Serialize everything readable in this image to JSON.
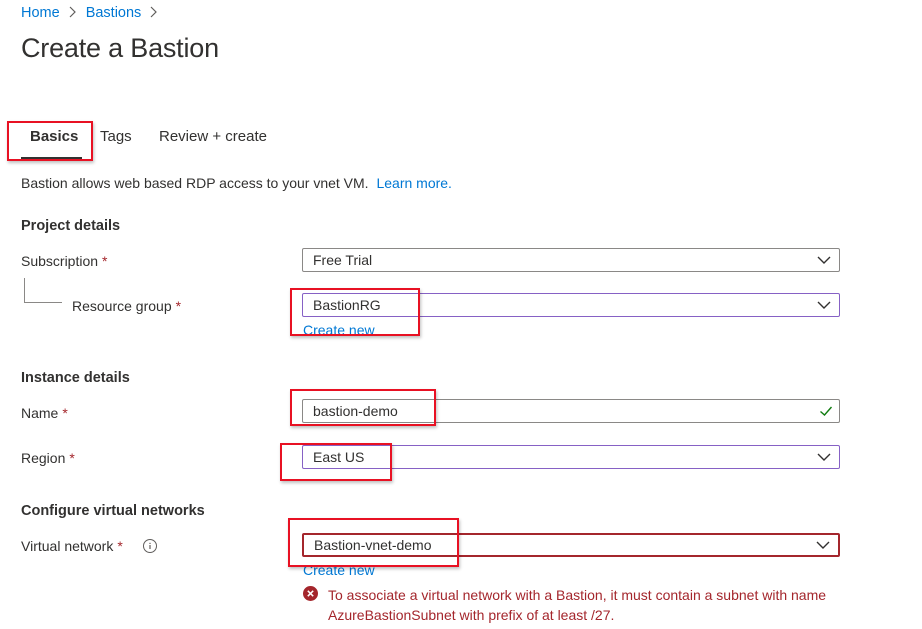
{
  "breadcrumb": {
    "home": "Home",
    "bastions": "Bastions",
    "sep": ">"
  },
  "page_title": "Create a Bastion",
  "tabs": [
    {
      "label": "Basics"
    },
    {
      "label": "Tags"
    },
    {
      "label": "Review + create"
    }
  ],
  "intro": {
    "text": "Bastion allows web based RDP access to your vnet VM.",
    "link": "Learn more."
  },
  "project": {
    "heading": "Project details",
    "subscription": {
      "label": "Subscription",
      "required": "*",
      "value": "Free Trial"
    },
    "resource_group": {
      "label": "Resource group",
      "required": "*",
      "value": "BastionRG",
      "create_new": "Create new"
    }
  },
  "instance": {
    "heading": "Instance details",
    "name": {
      "label": "Name",
      "required": "*",
      "value": "bastion-demo"
    },
    "region": {
      "label": "Region",
      "required": "*",
      "value": "East US"
    }
  },
  "vnet": {
    "heading": "Configure virtual networks",
    "virtual_network": {
      "label": "Virtual network",
      "required": "*",
      "value": "Bastion-vnet-demo",
      "create_new": "Create new"
    },
    "error": "To associate a virtual network with a Bastion, it must contain a subnet with name AzureBastionSubnet with prefix of at least /27."
  },
  "colors": {
    "accent": "#0078d4",
    "error": "#a4262c",
    "highlight": "#e81123",
    "valid": "#107c10"
  },
  "icons": [
    "chevron-right-icon",
    "chevron-down-icon",
    "checkmark-icon",
    "info-icon",
    "error-icon"
  ]
}
